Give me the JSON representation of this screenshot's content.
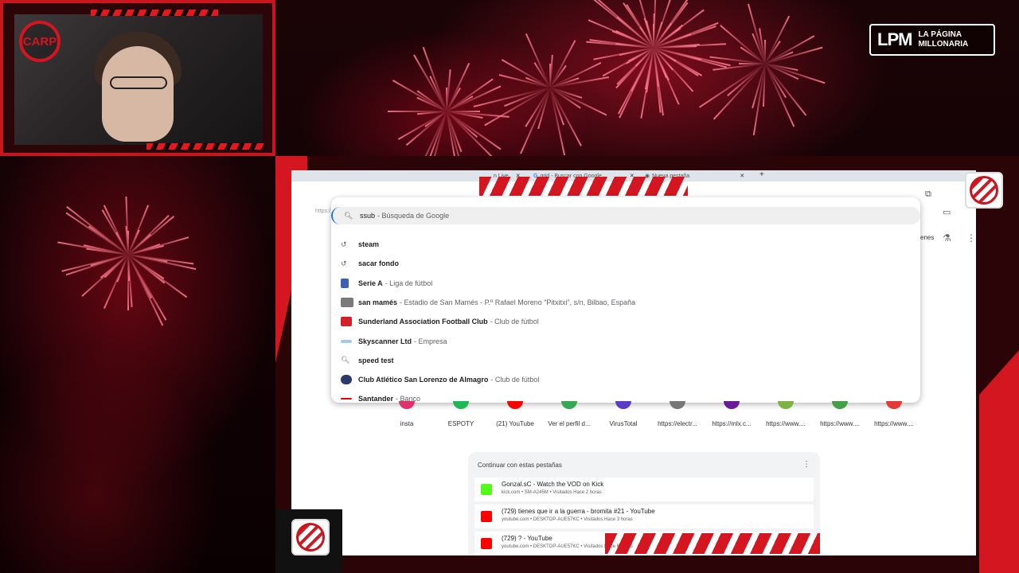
{
  "overlay": {
    "webcam_logo": "CARP",
    "lpm_logo": {
      "big": "LPM",
      "line1": "LA PÁGINA",
      "line2": "MILLONARIA"
    },
    "club_badge_top": "Club Atlético River Plate",
    "club_badge_bottom": "Club Atlético River Plate",
    "colors": {
      "accent": "#d41620",
      "dark": "#2a0406"
    }
  },
  "browser": {
    "tabs": [
      {
        "label": "n Live",
        "icon": "kick-icon"
      },
      {
        "label": "grid - Buscar con Google",
        "icon": "google-icon"
      },
      {
        "label": "Nueva pestaña",
        "icon": "chrome-icon"
      }
    ],
    "new_tab_symbol": "+",
    "address_stub": "https:/",
    "omnibox": {
      "input_value": "ssub",
      "input_suggest": "- Búsqueda de Google",
      "suggestions": [
        {
          "icon": "history-icon",
          "bold": "steam",
          "desc": ""
        },
        {
          "icon": "history-icon",
          "bold": "sacar fondo",
          "desc": ""
        },
        {
          "icon": "serie-a-logo",
          "bold": "Serie A",
          "desc": "- Liga de fútbol"
        },
        {
          "icon": "stadium-thumbnail",
          "bold": "san mamés",
          "desc": "- Estadio de San Mamés - P.º Rafael Moreno \"Pitxitxi\", s/n, Bilbao, España"
        },
        {
          "icon": "sunderland-logo",
          "bold": "Sunderland Association Football Club",
          "desc": "- Club de fútbol"
        },
        {
          "icon": "skyscanner-logo",
          "bold": "Skyscanner Ltd",
          "desc": "- Empresa"
        },
        {
          "icon": "search-icon",
          "bold": "speed test",
          "desc": ""
        },
        {
          "icon": "san-lorenzo-logo",
          "bold": "Club Atlético San Lorenzo de Almagro",
          "desc": "- Club de fútbol"
        },
        {
          "icon": "santander-logo",
          "bold": "Santander",
          "desc": "- Banco"
        }
      ]
    },
    "top_right": {
      "partial_text": "enes"
    },
    "shortcuts": [
      {
        "label": "insta",
        "color": "#e1306c"
      },
      {
        "label": "ESPOTY",
        "color": "#1db954"
      },
      {
        "label": "(21) YouTube",
        "color": "#ff0000"
      },
      {
        "label": "Ver el perfil d...",
        "color": "#34a853"
      },
      {
        "label": "VirusTotal",
        "color": "#5b3cc4"
      },
      {
        "label": "https://electr...",
        "color": "#777777"
      },
      {
        "label": "https://mlx.c...",
        "color": "#6a1b9a"
      },
      {
        "label": "https://www....",
        "color": "#7cb342"
      },
      {
        "label": "https://www....",
        "color": "#43a047"
      },
      {
        "label": "https://www....",
        "color": "#e53935"
      }
    ],
    "continue_card": {
      "title": "Continuar con estas pestañas",
      "menu_symbol": "⋮",
      "items": [
        {
          "title": "Gonzal.sC - Watch the VOD on Kick",
          "meta": "kick.com • SM-A245M • Visitados Hace 2 horas",
          "icon": "kick-icon",
          "color": "#53fc18"
        },
        {
          "title": "(729) tienes que ir a la guerra - bromita #21 - YouTube",
          "meta": "youtube.com • DESKTOP-AUE57KC • Visitados Hace 3 horas",
          "icon": "youtube-icon",
          "color": "#ff0000"
        },
        {
          "title": "(729) ? - YouTube",
          "meta": "youtube.com • DESKTOP-AUE57KC • Visitados Hace 6 horas",
          "icon": "youtube-icon",
          "color": "#ff0000"
        }
      ]
    }
  }
}
